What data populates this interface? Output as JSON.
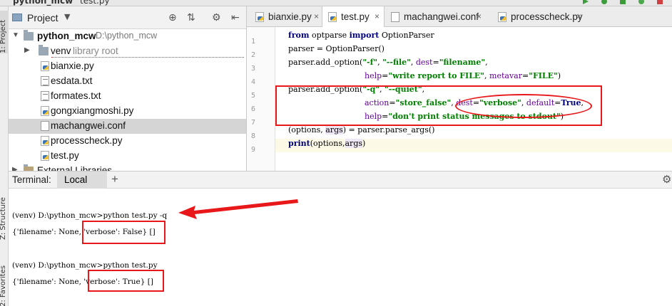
{
  "title_bar": {
    "project": "python_mcw",
    "file": "test.py"
  },
  "side_tabs": {
    "project": "1: Project",
    "structure": "Z: Structure",
    "favorites": "2: Favorites"
  },
  "project_panel": {
    "header": "Project",
    "root": {
      "name": "python_mcw",
      "path": "D:\\python_mcw"
    },
    "items": [
      {
        "name": "venv",
        "hint": "library root",
        "type": "folder"
      },
      {
        "name": "bianxie.py",
        "type": "py"
      },
      {
        "name": "esdata.txt",
        "type": "txt"
      },
      {
        "name": "formates.txt",
        "type": "txt"
      },
      {
        "name": "gongxiangmoshi.py",
        "type": "py"
      },
      {
        "name": "machangwei.conf",
        "type": "conf"
      },
      {
        "name": "processcheck.py",
        "type": "py"
      },
      {
        "name": "test.py",
        "type": "py"
      },
      {
        "name": "External Libraries",
        "type": "lib"
      }
    ]
  },
  "editor": {
    "tabs": [
      "bianxie.py",
      "test.py",
      "machangwei.conf",
      "processcheck.py"
    ],
    "active_tab": "test.py",
    "line_numbers": [
      "1",
      "2",
      "3",
      "4",
      "5",
      "6",
      "7",
      "8",
      "9"
    ],
    "code": {
      "l1_kw1": "from",
      "l1_mid": " optparse ",
      "l1_kw2": "import",
      "l1_rest": " OptionParser",
      "l2": "parser = OptionParser()",
      "l3_a": "parser.add_option(",
      "l3_s1": "\"-f\"",
      "l3_b": ", ",
      "l3_s2": "\"--file\"",
      "l3_c": ", ",
      "l3_k": "dest",
      "l3_d": "=",
      "l3_s3": "\"filename\"",
      "l3_e": ",",
      "l4_k1": "help",
      "l4_a": "=",
      "l4_s1": "\"write report to FILE\"",
      "l4_b": ", ",
      "l4_k2": "metavar",
      "l4_c": "=",
      "l4_s2": "\"FILE\"",
      "l4_d": ")",
      "l5_a": "parser.add_option(",
      "l5_s1": "\"-q\"",
      "l5_b": ", ",
      "l5_s2": "\"--quiet\"",
      "l5_c": ",",
      "l6_k1": "action",
      "l6_a": "=",
      "l6_s1": "\"store_false\"",
      "l6_b": ", ",
      "l6_k2": "dest",
      "l6_c": "=",
      "l6_s2": "\"verbose\"",
      "l6_d": ", ",
      "l6_k3": "default",
      "l6_e": "=",
      "l6_kw": "True",
      "l6_f": ",",
      "l7_k1": "help",
      "l7_a": "=",
      "l7_s1": "\"don't print status messages to stdout\"",
      "l7_b": ")",
      "l8_a": "(options, ",
      "l8_b": "args",
      "l8_c": ") = parser.parse_args()",
      "l9_kw": "print",
      "l9_rest": "(options,",
      "l9_args": "args",
      "l9_end": ")"
    }
  },
  "terminal": {
    "label": "Terminal:",
    "tab": "Local",
    "lines": [
      "(venv) D:\\python_mcw>python test.py -q",
      "{'filename': None, 'verbose': False} []",
      "(venv) D:\\python_mcw>python test.py",
      "{'filename': None, 'verbose': True} []"
    ]
  },
  "colors": {
    "annotation": "#e8171a",
    "keyword": "#000080",
    "string": "#008000",
    "kwarg": "#660099"
  }
}
